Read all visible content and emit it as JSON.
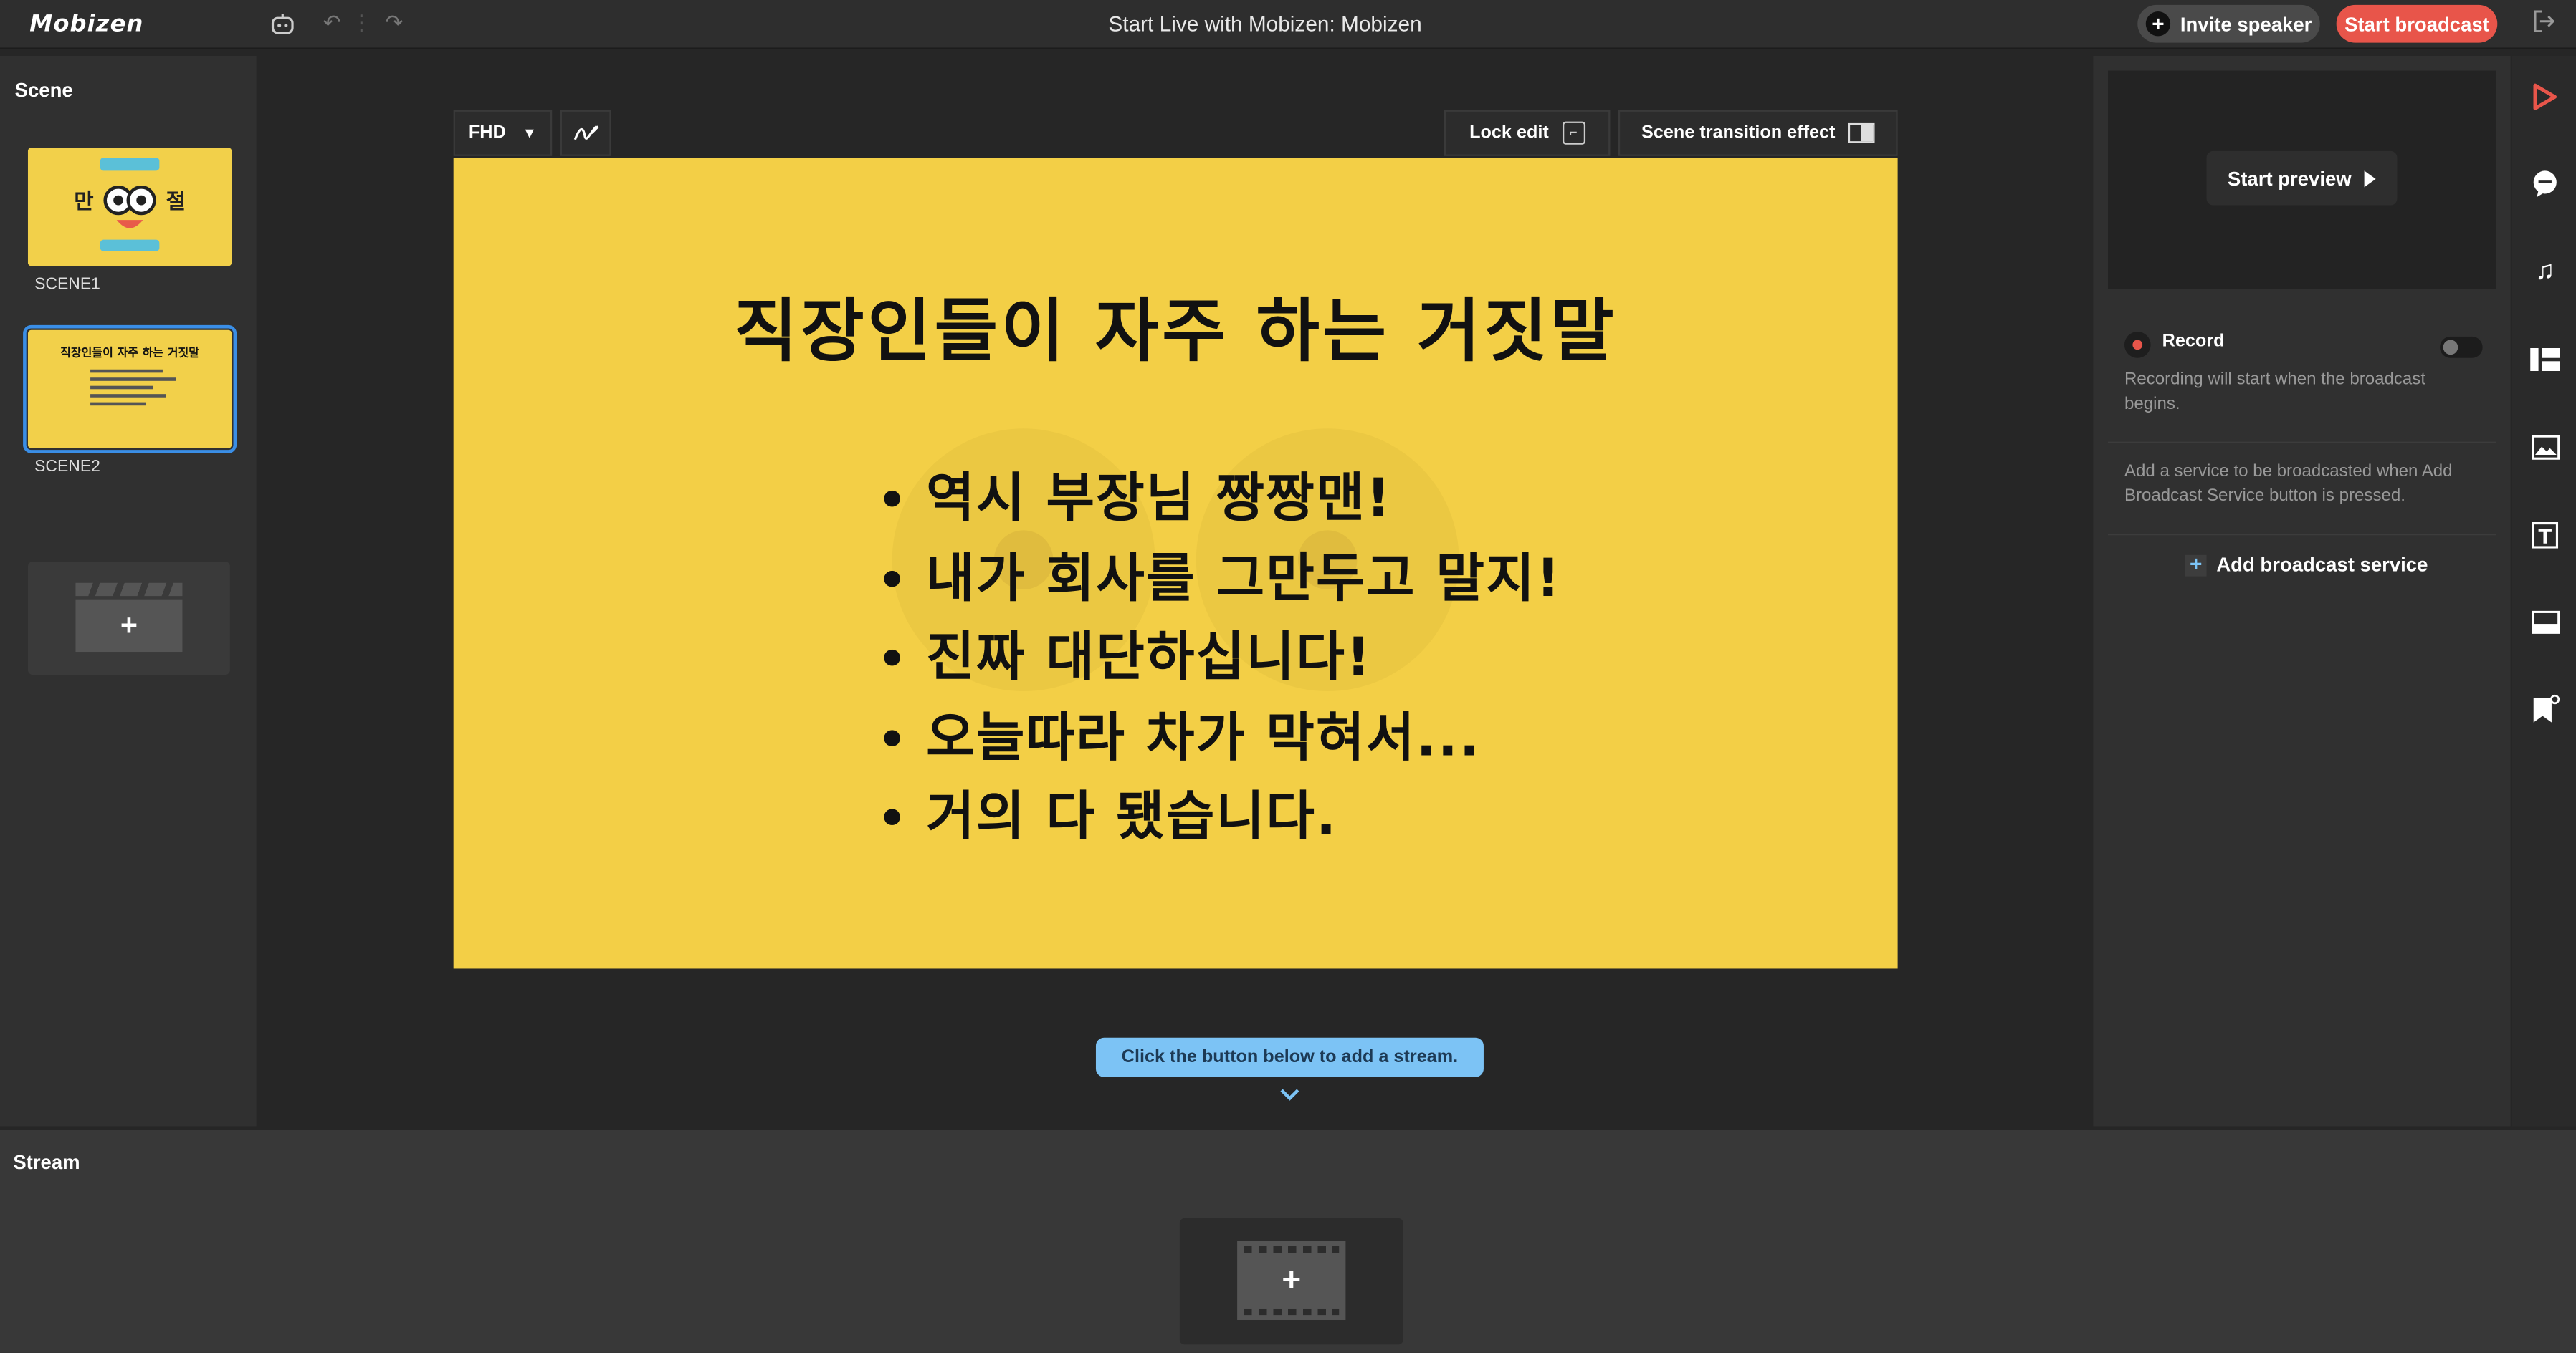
{
  "app": {
    "logo_text": "Mobizen",
    "window_title": "Start Live with Mobizen: Mobizen"
  },
  "topbar": {
    "invite_label": "Invite speaker",
    "start_broadcast_label": "Start broadcast",
    "icons": [
      "bot-icon",
      "undo-icon",
      "redo-icon",
      "exit-icon"
    ]
  },
  "scenes": {
    "title": "Scene",
    "items": [
      {
        "label": "SCENE1",
        "selected": false,
        "thumb_text": "만 ◉◉ 절"
      },
      {
        "label": "SCENE2",
        "selected": true,
        "thumb_title": "직장인들이 자주 하는 거짓말"
      }
    ]
  },
  "canvas_toolbar": {
    "resolution": "FHD",
    "lock_edit_label": "Lock edit",
    "transition_label": "Scene transition effect"
  },
  "slide": {
    "title": "직장인들이 자주 하는 거짓말",
    "bullets": [
      "역시 부장님 짱짱맨!",
      "내가 회사를 그만두고 말지!",
      "진짜 대단하십니다!",
      "오늘따라 차가 막혀서...",
      "거의 다 됐습니다."
    ],
    "background_color": "#f3cf46"
  },
  "hint": {
    "text": "Click the button below to add a stream."
  },
  "right_panel": {
    "start_preview_label": "Start preview",
    "record_label": "Record",
    "record_enabled": false,
    "record_note": "Recording will start when the broadcast begins.",
    "service_note": "Add a service to be broadcasted when Add Broadcast Service button is pressed.",
    "add_service_label": "Add broadcast service"
  },
  "icon_rail": [
    "play-icon",
    "chat-icon",
    "music-icon",
    "layout-icon",
    "image-icon",
    "text-icon",
    "caption-icon",
    "bookmark-icon"
  ],
  "stream": {
    "title": "Stream"
  },
  "colors": {
    "accent_red": "#e8554a",
    "accent_blue": "#7cc3f5",
    "selection_blue": "#3a8ee6"
  }
}
